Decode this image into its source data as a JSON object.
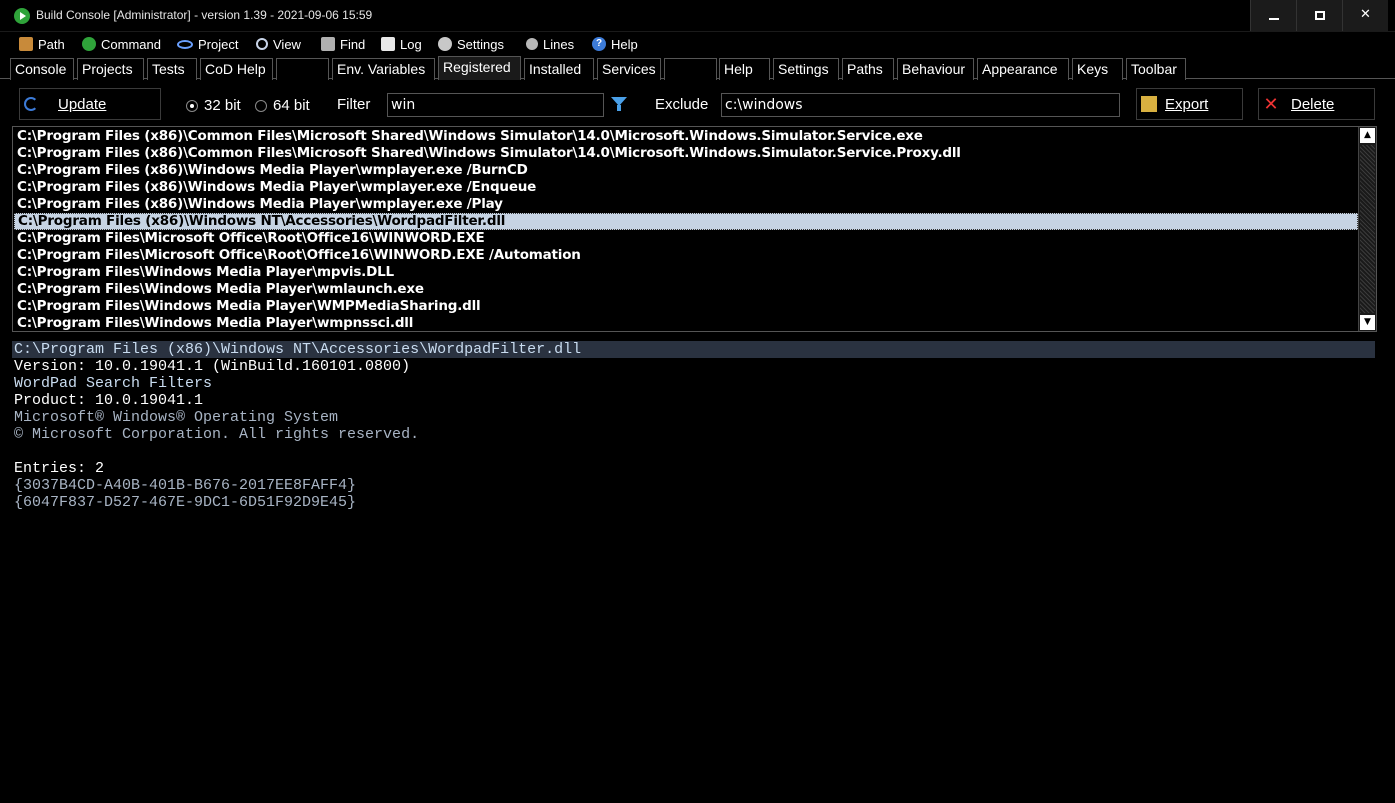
{
  "window": {
    "title": "Build Console [Administrator] - version 1.39 - 2021-09-06 15:59",
    "controls": {
      "minimize": "–",
      "maximize": "□",
      "close": "✕"
    }
  },
  "menu": [
    {
      "label": "Path",
      "icon": "path-icon"
    },
    {
      "label": "Command",
      "icon": "command-icon"
    },
    {
      "label": "Project",
      "icon": "project-icon"
    },
    {
      "label": "View",
      "icon": "view-icon"
    },
    {
      "label": "Find",
      "icon": "find-icon"
    },
    {
      "label": "Log",
      "icon": "log-icon"
    },
    {
      "label": "Settings",
      "icon": "settings-icon"
    },
    {
      "label": "Lines",
      "icon": "lines-icon"
    },
    {
      "label": "Help",
      "icon": "help-icon"
    }
  ],
  "tabs": [
    {
      "label": "Console"
    },
    {
      "label": "Projects"
    },
    {
      "label": "Tests"
    },
    {
      "label": "CoD Help"
    },
    {
      "label": ""
    },
    {
      "label": "Env. Variables"
    },
    {
      "label": "Registered",
      "active": true
    },
    {
      "label": "Installed"
    },
    {
      "label": "Services"
    },
    {
      "label": ""
    },
    {
      "label": "Help"
    },
    {
      "label": "Settings"
    },
    {
      "label": "Paths"
    },
    {
      "label": "Behaviour"
    },
    {
      "label": "Appearance"
    },
    {
      "label": "Keys"
    },
    {
      "label": "Toolbar"
    }
  ],
  "toolbar": {
    "update_label": "Update",
    "bit32_label": "32 bit",
    "bit64_label": "64 bit",
    "selected_bits": "32 bit",
    "filter_label": "Filter",
    "filter_value": "win",
    "exclude_label": "Exclude",
    "exclude_value": "c:\\windows",
    "export_label": "Export",
    "delete_label": "Delete"
  },
  "list": {
    "rows": [
      "C:\\Program Files (x86)\\Common Files\\Microsoft Shared\\Windows Simulator\\14.0\\Microsoft.Windows.Simulator.Service.exe",
      "C:\\Program Files (x86)\\Common Files\\Microsoft Shared\\Windows Simulator\\14.0\\Microsoft.Windows.Simulator.Service.Proxy.dll",
      "C:\\Program Files (x86)\\Windows Media Player\\wmplayer.exe /BurnCD",
      "C:\\Program Files (x86)\\Windows Media Player\\wmplayer.exe /Enqueue",
      "C:\\Program Files (x86)\\Windows Media Player\\wmplayer.exe /Play",
      "C:\\Program Files (x86)\\Windows NT\\Accessories\\WordpadFilter.dll",
      "C:\\Program Files\\Microsoft Office\\Root\\Office16\\WINWORD.EXE",
      "C:\\Program Files\\Microsoft Office\\Root\\Office16\\WINWORD.EXE /Automation",
      "C:\\Program Files\\Windows Media Player\\mpvis.DLL",
      "C:\\Program Files\\Windows Media Player\\wmlaunch.exe",
      "C:\\Program Files\\Windows Media Player\\WMPMediaSharing.dll",
      "C:\\Program Files\\Windows Media Player\\wmpnssci.dll"
    ],
    "selected_index": 5,
    "scroll_up": "▲",
    "scroll_down": "▼"
  },
  "detail": {
    "header": "C:\\Program Files (x86)\\Windows NT\\Accessories\\WordpadFilter.dll",
    "version": "Version: 10.0.19041.1 (WinBuild.160101.0800)",
    "description": "WordPad Search Filters",
    "product": "Product: 10.0.19041.1",
    "product_name": "Microsoft® Windows® Operating System",
    "copyright": "© Microsoft Corporation. All rights reserved.",
    "entries_label": "Entries: 2",
    "entries": [
      "{3037B4CD-A40B-401B-B676-2017EE8FAFF4}",
      "{6047F837-D527-467E-9DC1-6D51F92D9E45}"
    ]
  }
}
